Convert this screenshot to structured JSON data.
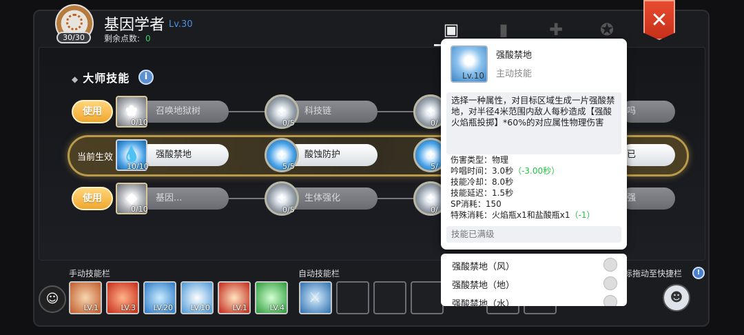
{
  "header": {
    "title": "基因学者",
    "level": "Lv.30",
    "points_label": "剩余点数:",
    "points_value": "0",
    "avatar_count": "30/30"
  },
  "section": {
    "title": "大师技能",
    "info": "i",
    "use_label": "使用",
    "current_label": "当前生效"
  },
  "rows": [
    {
      "skills": [
        {
          "name": "召唤地狱树",
          "level": "0/10"
        },
        {
          "name": "科技链",
          "level": "0/5"
        },
        {
          "name": "",
          "level": "0/"
        },
        {
          "name": "吗",
          "level": ""
        }
      ]
    },
    {
      "skills": [
        {
          "name": "强酸禁地",
          "level": "10/10"
        },
        {
          "name": "酸蚀防护",
          "level": "5/5"
        },
        {
          "name": "",
          "level": "5/"
        },
        {
          "name": "已",
          "level": ""
        }
      ]
    },
    {
      "skills": [
        {
          "name": "基因...",
          "level": "0/10"
        },
        {
          "name": "生体强化",
          "level": "0/5"
        },
        {
          "name": "",
          "level": "0/"
        },
        {
          "name": "强",
          "level": ""
        }
      ]
    }
  ],
  "bottom": {
    "manual_label": "手动技能栏",
    "auto_label": "自动技能栏",
    "hint": "标拖动至快捷栏",
    "manual_slots": [
      "LV.1",
      "LV.3",
      "LV.20",
      "LV.10",
      "LV.1",
      "LV.4"
    ]
  },
  "tooltip": {
    "name": "强酸禁地",
    "type": "主动技能",
    "icon_level": "Lv.10",
    "description": "选择一种属性，对目标区域生成一片强酸禁地，对半径4米范围内敌人每秒造成【强酸火焰瓶投掷】*60%的对应属性物理伤害",
    "stats": {
      "damage_type": "伤害类型：物理",
      "cast_time": "吟唱时间：3.0秒",
      "cast_bonus": "（-3.00秒）",
      "cooldown": "技能冷却：8.0秒",
      "delay": "技能延迟：1.5秒",
      "sp": "SP消耗：150",
      "special": "特殊消耗：火焰瓶x1和盐酸瓶x1",
      "special_bonus": "（-1）"
    },
    "max_text": "技能已满级"
  },
  "options": [
    "强酸禁地（风）",
    "强酸禁地（地）",
    "强酸禁地（水）"
  ],
  "close": "✕"
}
